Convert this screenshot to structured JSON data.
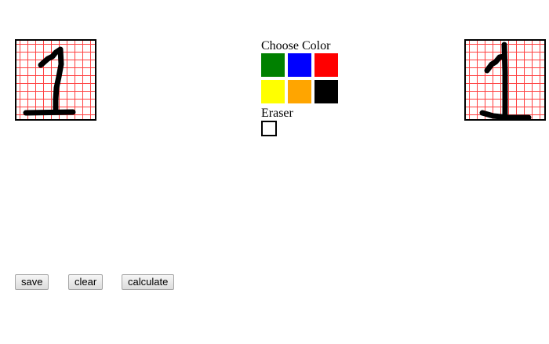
{
  "palette": {
    "title": "Choose Color",
    "colors": [
      "#008000",
      "#0000ff",
      "#ff0000",
      "#ffff00",
      "#ffa500",
      "#000000"
    ],
    "eraser_label": "Eraser"
  },
  "buttons": {
    "save": "save",
    "clear": "clear",
    "calculate": "calculate"
  },
  "grid_color": "#ff4040",
  "stroke_color": "#000000"
}
